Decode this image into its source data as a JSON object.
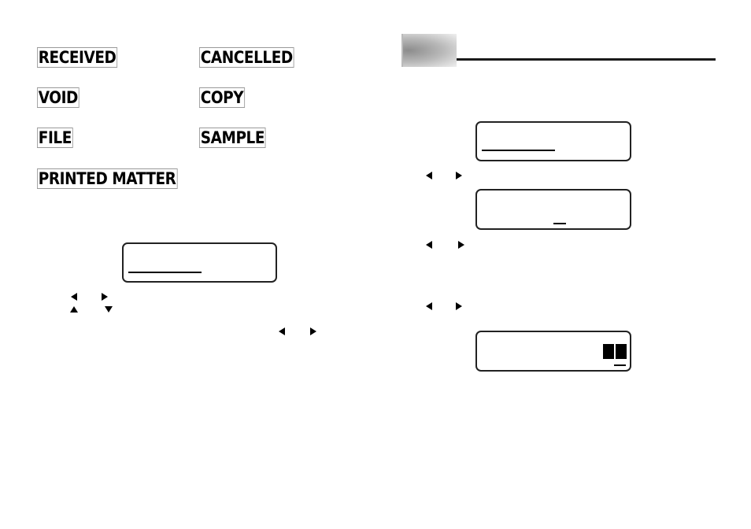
{
  "stamps": [
    {
      "label": "RECEIVED"
    },
    {
      "label": "CANCELLED"
    },
    {
      "label": "VOID"
    },
    {
      "label": "COPY"
    },
    {
      "label": "FILE"
    },
    {
      "label": "SAMPLE"
    },
    {
      "label": "PRINTED MATTER"
    }
  ],
  "icons": {
    "left_arrow": "left-triangle-icon",
    "right_arrow": "right-triangle-icon",
    "up_arrow": "up-triangle-icon",
    "down_arrow": "down-triangle-icon"
  },
  "colors": {
    "ink": "#000000",
    "header_gradient_dark": "#8c8c8c",
    "header_gradient_light": "#efefef"
  }
}
